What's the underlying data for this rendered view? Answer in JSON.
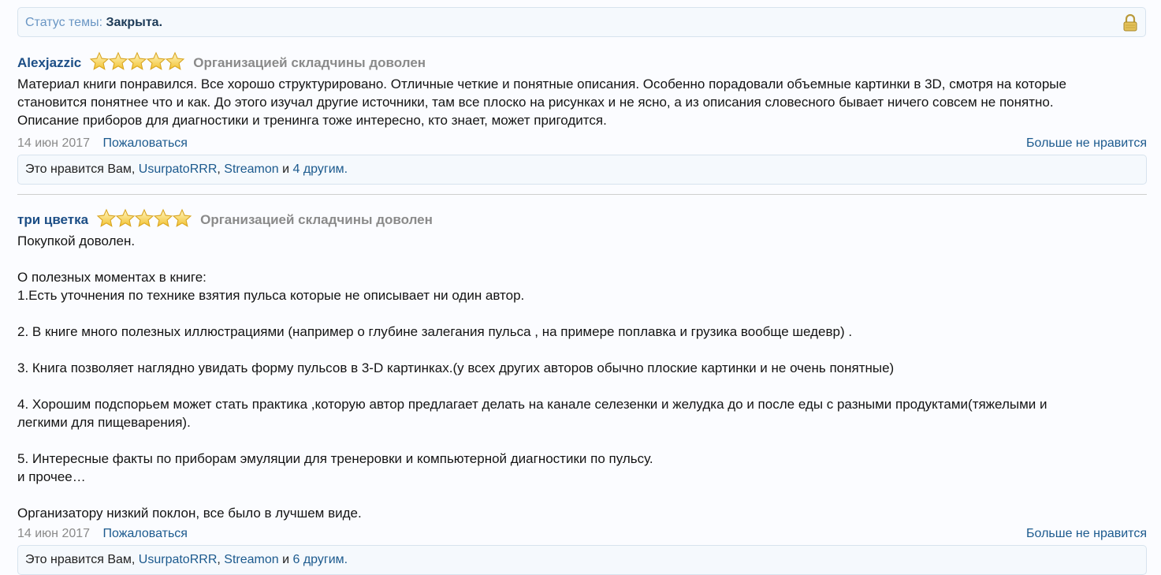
{
  "thread_status": {
    "label": "Статус темы:",
    "value": "Закрыта."
  },
  "posts": [
    {
      "author": "Alexjazzic",
      "stars": 5,
      "rating_text": "Организацией складчины доволен",
      "lines": [
        "Материал книги понравился. Все хорошо структурировано. Отличные четкие и понятные описания. Особенно порадовали объемные картинки в 3D, смотря на которые",
        "становится понятнее что и как. До этого изучал другие источники, там все плоско на рисунках и не ясно, а из описания словесного бывает ничего совсем не понятно.",
        "Описание приборов для диагностики и тренинга тоже интересно, кто знает, может пригодится."
      ],
      "date": "14 июн 2017",
      "report_label": "Пожаловаться",
      "unlike_label": "Больше не нравится",
      "likes": {
        "prefix": "Это нравится Вам, ",
        "user1": "UsurpatoRRR",
        "sep": ", ",
        "user2": "Streamon",
        "and": " и ",
        "others": "4 другим."
      }
    },
    {
      "author": "три цветка",
      "stars": 5,
      "rating_text": "Организацией складчины доволен",
      "lines": [
        "Покупкой доволен.",
        "",
        "О полезных моментах в книге:",
        "1.Есть уточнения по технике взятия пульса которые не описывает ни один автор.",
        "",
        "2. В книге много полезных иллюстрациями (например о глубине залегания пульса , на примере поплавка и грузика вообще шедевр) .",
        "",
        "3. Книга позволяет наглядно увидать форму пульсов в 3-D картинках.(у всех других авторов обычно плоские картинки и не очень понятные)",
        "",
        "4. Хорошим подспорьем может стать практика ,которую автор предлагает делать на канале селезенки и желудка до и после еды с разными продуктами(тяжелыми и",
        "легкими для пищеварения).",
        "",
        "5. Интересные факты по приборам эмуляции для тренеровки и компьютерной диагностики по пульсу.",
        "и прочее…",
        "",
        "Организатору низкий поклон, все было в лучшем виде."
      ],
      "date": "14 июн 2017",
      "report_label": "Пожаловаться",
      "unlike_label": "Больше не нравится",
      "likes": {
        "prefix": "Это нравится Вам, ",
        "user1": "UsurpatoRRR",
        "sep": ", ",
        "user2": "Streamon",
        "and": " и ",
        "others": "6 другим."
      }
    }
  ]
}
